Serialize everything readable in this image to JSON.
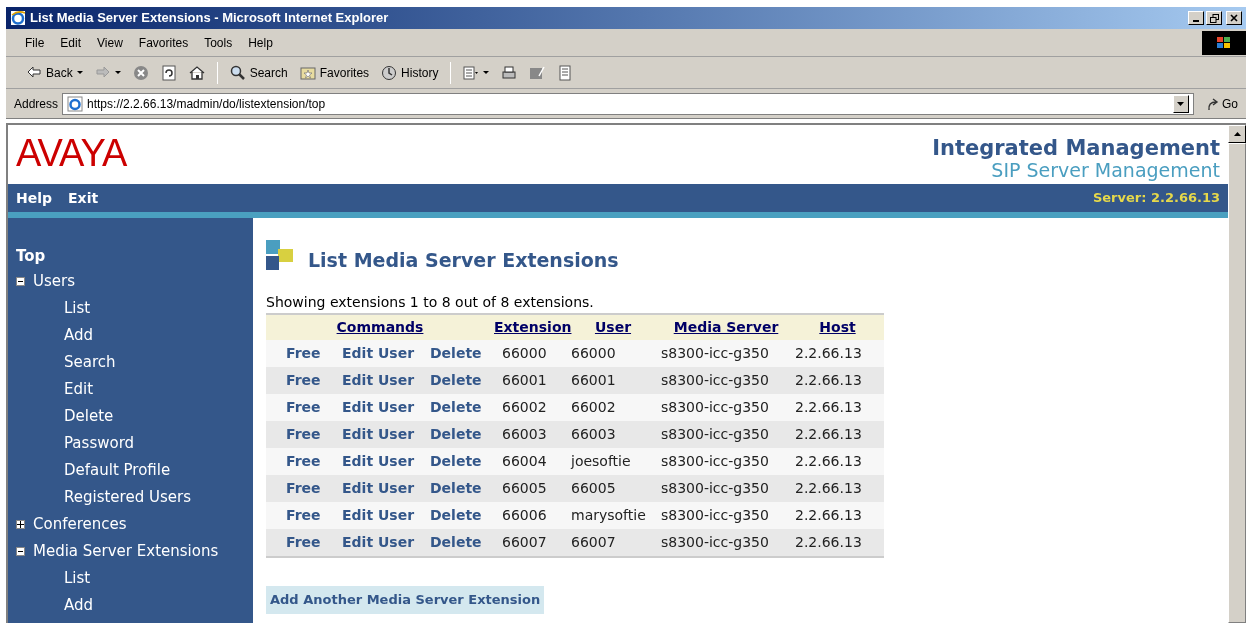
{
  "window": {
    "title": "List Media Server Extensions - Microsoft Internet Explorer"
  },
  "menu_bar": [
    "File",
    "Edit",
    "View",
    "Favorites",
    "Tools",
    "Help"
  ],
  "toolbar": [
    {
      "kind": "back",
      "label": "Back"
    },
    {
      "kind": "forward"
    },
    {
      "kind": "stop"
    },
    {
      "kind": "refresh"
    },
    {
      "kind": "home"
    },
    {
      "kind": "search",
      "label": "Search"
    },
    {
      "kind": "favorites",
      "label": "Favorites"
    },
    {
      "kind": "history",
      "label": "History"
    },
    {
      "kind": "mail"
    },
    {
      "kind": "print"
    },
    {
      "kind": "edit"
    },
    {
      "kind": "discuss"
    }
  ],
  "address_bar": {
    "label": "Address",
    "value": "https://2.2.66.13/madmin/do/listextension/top",
    "go": "Go"
  },
  "header": {
    "logo": "AVAYA",
    "title": "Integrated Management",
    "subtitle": "SIP Server Management"
  },
  "nav": {
    "links": [
      "Help",
      "Exit"
    ],
    "server": "Server: 2.2.66.13"
  },
  "sidebar": {
    "top": "Top",
    "items": [
      {
        "label": "Users",
        "expanded": true,
        "children": [
          {
            "label": "List"
          },
          {
            "label": "Add"
          },
          {
            "label": "Search"
          },
          {
            "label": "Edit"
          },
          {
            "label": "Delete"
          },
          {
            "label": "Password"
          },
          {
            "label": "Default Profile"
          },
          {
            "label": "Registered Users"
          }
        ]
      },
      {
        "label": "Conferences",
        "expanded": false
      },
      {
        "label": "Media Server Extensions",
        "expanded": true,
        "children": [
          {
            "label": "List"
          },
          {
            "label": "Add"
          }
        ]
      }
    ]
  },
  "page": {
    "title": "List Media Server Extensions",
    "summary": "Showing extensions 1 to 8 out of 8 extensions.",
    "table": {
      "columns": [
        "Commands",
        "Extension",
        "User",
        "Media Server",
        "Host"
      ],
      "rows": [
        {
          "commands": [
            "Free",
            "Edit User",
            "Delete"
          ],
          "extension": "66000",
          "user": "66000",
          "media_server": "s8300-icc-g350",
          "host": "2.2.66.13"
        },
        {
          "commands": [
            "Free",
            "Edit User",
            "Delete"
          ],
          "extension": "66001",
          "user": "66001",
          "media_server": "s8300-icc-g350",
          "host": "2.2.66.13"
        },
        {
          "commands": [
            "Free",
            "Edit User",
            "Delete"
          ],
          "extension": "66002",
          "user": "66002",
          "media_server": "s8300-icc-g350",
          "host": "2.2.66.13"
        },
        {
          "commands": [
            "Free",
            "Edit User",
            "Delete"
          ],
          "extension": "66003",
          "user": "66003",
          "media_server": "s8300-icc-g350",
          "host": "2.2.66.13"
        },
        {
          "commands": [
            "Free",
            "Edit User",
            "Delete"
          ],
          "extension": "66004",
          "user": "joesoftie",
          "media_server": "s8300-icc-g350",
          "host": "2.2.66.13"
        },
        {
          "commands": [
            "Free",
            "Edit User",
            "Delete"
          ],
          "extension": "66005",
          "user": "66005",
          "media_server": "s8300-icc-g350",
          "host": "2.2.66.13"
        },
        {
          "commands": [
            "Free",
            "Edit User",
            "Delete"
          ],
          "extension": "66006",
          "user": "marysoftie",
          "media_server": "s8300-icc-g350",
          "host": "2.2.66.13"
        },
        {
          "commands": [
            "Free",
            "Edit User",
            "Delete"
          ],
          "extension": "66007",
          "user": "66007",
          "media_server": "s8300-icc-g350",
          "host": "2.2.66.13"
        }
      ]
    },
    "add_button": "Add Another Media Server Extension"
  }
}
